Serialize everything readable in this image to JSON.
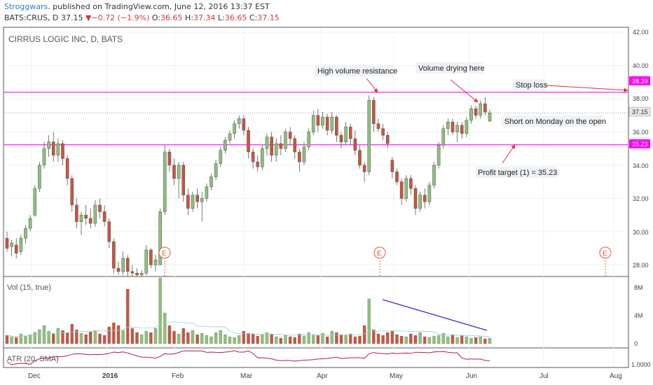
{
  "header": {
    "user": "Stroggwars",
    "published": ". published on TradingView.com, June 12, 2016 13:37 EST",
    "symbol": "BATS:CRUS, D",
    "last": "37.15",
    "change": "−0.72 (−1.9%)",
    "o_label": "O:",
    "o_val": "36.65",
    "h_label": "H:",
    "h_val": "37.34",
    "l_label": "L:",
    "l_val": "36.65",
    "c_label": "C:",
    "c_val": "37.15"
  },
  "price_pane": {
    "title": "CIRRUS LOGIC INC, D, BATS",
    "yticks": [
      "42.00",
      "40.00",
      "38.00",
      "36.00",
      "34.00",
      "32.00",
      "30.00",
      "28.00"
    ],
    "tags": [
      {
        "label": "38.39",
        "value": 38.39,
        "type": "line"
      },
      {
        "label": "37.15",
        "value": 37.15,
        "type": "last"
      },
      {
        "label": "35.23",
        "value": 35.23,
        "type": "line"
      }
    ],
    "annotations": [
      "High volume resistance",
      "Volume drying here",
      "Stop loss",
      "Short on Monday on the open",
      "Profit target (1) = 35.23"
    ],
    "earnings_marker": "E"
  },
  "volume_pane": {
    "title": "Vol (15, true)",
    "yticks": [
      "8M",
      "4M",
      "0"
    ]
  },
  "atr_pane": {
    "title": "ATR (20, SMA)",
    "ytick": "1.0000"
  },
  "xaxis": {
    "ticks": [
      "Dec",
      "2016",
      "Feb",
      "Mar",
      "Apr",
      "May",
      "Jun",
      "Jul",
      "Aug"
    ]
  },
  "colors": {
    "up": "#8fc07a",
    "down": "#c8553f",
    "level_line": "#ff00ff",
    "arrow": "#e0303a",
    "trend": "#3030d8"
  },
  "chart_data": {
    "type": "candlestick",
    "title": "CIRRUS LOGIC INC, D, BATS",
    "ylim": [
      27.3,
      42.3
    ],
    "levels": [
      38.39,
      35.23
    ],
    "last_price": 37.15,
    "candles": [
      {
        "o": 29.6,
        "h": 30.0,
        "l": 28.8,
        "c": 29.0
      },
      {
        "o": 29.1,
        "h": 29.5,
        "l": 28.5,
        "c": 29.3
      },
      {
        "o": 29.2,
        "h": 29.6,
        "l": 28.4,
        "c": 28.7
      },
      {
        "o": 28.8,
        "h": 29.8,
        "l": 28.6,
        "c": 29.6
      },
      {
        "o": 29.6,
        "h": 30.4,
        "l": 29.3,
        "c": 30.2
      },
      {
        "o": 30.2,
        "h": 31.0,
        "l": 30.0,
        "c": 30.8
      },
      {
        "o": 31.0,
        "h": 32.8,
        "l": 30.9,
        "c": 32.6
      },
      {
        "o": 32.6,
        "h": 34.2,
        "l": 32.4,
        "c": 34.0
      },
      {
        "o": 34.0,
        "h": 35.4,
        "l": 33.8,
        "c": 35.0
      },
      {
        "o": 35.0,
        "h": 35.8,
        "l": 34.5,
        "c": 35.4
      },
      {
        "o": 35.4,
        "h": 36.0,
        "l": 34.2,
        "c": 34.6
      },
      {
        "o": 34.6,
        "h": 35.6,
        "l": 34.2,
        "c": 35.3
      },
      {
        "o": 35.3,
        "h": 35.5,
        "l": 34.0,
        "c": 34.4
      },
      {
        "o": 34.4,
        "h": 34.6,
        "l": 32.8,
        "c": 33.2
      },
      {
        "o": 33.2,
        "h": 33.4,
        "l": 31.2,
        "c": 31.6
      },
      {
        "o": 31.6,
        "h": 32.0,
        "l": 30.2,
        "c": 30.6
      },
      {
        "o": 30.6,
        "h": 31.2,
        "l": 29.8,
        "c": 31.0
      },
      {
        "o": 31.0,
        "h": 31.6,
        "l": 30.4,
        "c": 30.8
      },
      {
        "o": 30.8,
        "h": 31.4,
        "l": 30.2,
        "c": 30.5
      },
      {
        "o": 30.5,
        "h": 31.9,
        "l": 30.3,
        "c": 31.6
      },
      {
        "o": 31.6,
        "h": 32.0,
        "l": 30.8,
        "c": 31.2
      },
      {
        "o": 31.2,
        "h": 31.6,
        "l": 30.3,
        "c": 30.6
      },
      {
        "o": 30.6,
        "h": 30.8,
        "l": 29.0,
        "c": 29.4
      },
      {
        "o": 29.4,
        "h": 29.6,
        "l": 27.5,
        "c": 27.8
      },
      {
        "o": 27.8,
        "h": 28.2,
        "l": 27.4,
        "c": 27.6
      },
      {
        "o": 27.6,
        "h": 28.8,
        "l": 27.4,
        "c": 28.4
      },
      {
        "o": 28.4,
        "h": 28.6,
        "l": 27.3,
        "c": 27.6
      },
      {
        "o": 27.6,
        "h": 28.0,
        "l": 27.3,
        "c": 27.5
      },
      {
        "o": 27.5,
        "h": 27.8,
        "l": 27.3,
        "c": 27.4
      },
      {
        "o": 27.4,
        "h": 27.7,
        "l": 27.3,
        "c": 27.5
      },
      {
        "o": 27.5,
        "h": 29.2,
        "l": 27.4,
        "c": 28.9
      },
      {
        "o": 28.9,
        "h": 29.0,
        "l": 27.8,
        "c": 28.0
      },
      {
        "o": 28.0,
        "h": 28.6,
        "l": 27.6,
        "c": 28.3
      },
      {
        "o": 28.0,
        "h": 31.4,
        "l": 29.6,
        "c": 31.2
      },
      {
        "o": 31.2,
        "h": 35.2,
        "l": 31.0,
        "c": 34.8
      },
      {
        "o": 34.8,
        "h": 35.0,
        "l": 33.6,
        "c": 34.0
      },
      {
        "o": 34.0,
        "h": 34.4,
        "l": 32.8,
        "c": 33.2
      },
      {
        "o": 33.2,
        "h": 34.2,
        "l": 32.0,
        "c": 34.0
      },
      {
        "o": 34.0,
        "h": 34.2,
        "l": 31.8,
        "c": 32.2
      },
      {
        "o": 32.2,
        "h": 32.6,
        "l": 31.0,
        "c": 31.4
      },
      {
        "o": 31.4,
        "h": 32.4,
        "l": 31.2,
        "c": 32.2
      },
      {
        "o": 32.2,
        "h": 32.6,
        "l": 31.4,
        "c": 31.8
      },
      {
        "o": 31.8,
        "h": 32.4,
        "l": 30.6,
        "c": 32.0
      },
      {
        "o": 32.0,
        "h": 32.9,
        "l": 31.8,
        "c": 32.7
      },
      {
        "o": 32.7,
        "h": 33.5,
        "l": 32.5,
        "c": 33.3
      },
      {
        "o": 33.3,
        "h": 34.3,
        "l": 33.1,
        "c": 34.1
      },
      {
        "o": 34.1,
        "h": 35.1,
        "l": 33.9,
        "c": 34.9
      },
      {
        "o": 34.9,
        "h": 35.7,
        "l": 34.7,
        "c": 35.5
      },
      {
        "o": 35.5,
        "h": 36.1,
        "l": 35.3,
        "c": 35.9
      },
      {
        "o": 35.9,
        "h": 36.7,
        "l": 35.6,
        "c": 36.5
      },
      {
        "o": 36.5,
        "h": 37.0,
        "l": 36.2,
        "c": 36.8
      },
      {
        "o": 36.8,
        "h": 37.0,
        "l": 35.8,
        "c": 36.1
      },
      {
        "o": 36.1,
        "h": 36.3,
        "l": 34.4,
        "c": 34.8
      },
      {
        "o": 34.8,
        "h": 35.0,
        "l": 33.8,
        "c": 34.2
      },
      {
        "o": 34.2,
        "h": 34.6,
        "l": 33.6,
        "c": 33.9
      },
      {
        "o": 33.9,
        "h": 35.2,
        "l": 33.7,
        "c": 35.0
      },
      {
        "o": 35.0,
        "h": 35.9,
        "l": 34.6,
        "c": 35.7
      },
      {
        "o": 35.7,
        "h": 36.0,
        "l": 34.2,
        "c": 34.6
      },
      {
        "o": 34.6,
        "h": 35.6,
        "l": 34.2,
        "c": 35.3
      },
      {
        "o": 35.3,
        "h": 35.8,
        "l": 34.6,
        "c": 35.0
      },
      {
        "o": 35.0,
        "h": 36.2,
        "l": 34.8,
        "c": 36.0
      },
      {
        "o": 36.0,
        "h": 36.3,
        "l": 35.2,
        "c": 35.6
      },
      {
        "o": 35.6,
        "h": 35.8,
        "l": 34.4,
        "c": 34.8
      },
      {
        "o": 34.8,
        "h": 35.0,
        "l": 33.6,
        "c": 34.2
      },
      {
        "o": 34.2,
        "h": 35.4,
        "l": 34.0,
        "c": 35.1
      },
      {
        "o": 35.1,
        "h": 36.2,
        "l": 34.9,
        "c": 36.0
      },
      {
        "o": 36.0,
        "h": 37.3,
        "l": 35.8,
        "c": 37.0
      },
      {
        "o": 37.0,
        "h": 37.4,
        "l": 36.0,
        "c": 36.4
      },
      {
        "o": 36.4,
        "h": 37.2,
        "l": 36.2,
        "c": 36.9
      },
      {
        "o": 36.9,
        "h": 37.1,
        "l": 35.8,
        "c": 36.1
      },
      {
        "o": 36.1,
        "h": 37.2,
        "l": 35.9,
        "c": 36.9
      },
      {
        "o": 36.9,
        "h": 37.0,
        "l": 35.4,
        "c": 35.8
      },
      {
        "o": 35.8,
        "h": 36.0,
        "l": 35.0,
        "c": 35.4
      },
      {
        "o": 35.4,
        "h": 36.6,
        "l": 35.2,
        "c": 36.3
      },
      {
        "o": 36.3,
        "h": 36.5,
        "l": 35.2,
        "c": 35.6
      },
      {
        "o": 35.6,
        "h": 36.1,
        "l": 34.6,
        "c": 34.9
      },
      {
        "o": 34.9,
        "h": 35.2,
        "l": 33.8,
        "c": 34.0
      },
      {
        "o": 34.0,
        "h": 34.2,
        "l": 33.0,
        "c": 33.6
      },
      {
        "o": 33.6,
        "h": 38.2,
        "l": 33.4,
        "c": 37.9
      },
      {
        "o": 37.9,
        "h": 38.1,
        "l": 36.0,
        "c": 36.5
      },
      {
        "o": 36.5,
        "h": 36.8,
        "l": 36.0,
        "c": 36.2
      },
      {
        "o": 36.2,
        "h": 36.5,
        "l": 35.5,
        "c": 35.8
      },
      {
        "o": 35.8,
        "h": 36.0,
        "l": 35.0,
        "c": 35.3
      },
      {
        "o": 34.3,
        "h": 34.5,
        "l": 33.2,
        "c": 33.6
      },
      {
        "o": 33.6,
        "h": 33.8,
        "l": 32.8,
        "c": 33.0
      },
      {
        "o": 33.0,
        "h": 33.2,
        "l": 31.6,
        "c": 32.0
      },
      {
        "o": 32.0,
        "h": 33.4,
        "l": 31.8,
        "c": 33.2
      },
      {
        "o": 33.2,
        "h": 33.4,
        "l": 32.2,
        "c": 32.6
      },
      {
        "o": 32.6,
        "h": 32.8,
        "l": 31.0,
        "c": 31.4
      },
      {
        "o": 31.4,
        "h": 32.4,
        "l": 31.2,
        "c": 32.2
      },
      {
        "o": 32.2,
        "h": 32.6,
        "l": 31.4,
        "c": 31.8
      },
      {
        "o": 31.8,
        "h": 33.0,
        "l": 31.6,
        "c": 32.8
      },
      {
        "o": 32.8,
        "h": 34.2,
        "l": 32.6,
        "c": 34.0
      },
      {
        "o": 34.0,
        "h": 35.4,
        "l": 33.8,
        "c": 35.2
      },
      {
        "o": 35.2,
        "h": 36.4,
        "l": 35.0,
        "c": 36.2
      },
      {
        "o": 36.2,
        "h": 36.8,
        "l": 35.8,
        "c": 36.6
      },
      {
        "o": 36.6,
        "h": 36.8,
        "l": 35.8,
        "c": 36.0
      },
      {
        "o": 36.0,
        "h": 36.6,
        "l": 35.4,
        "c": 36.4
      },
      {
        "o": 36.4,
        "h": 36.6,
        "l": 35.6,
        "c": 35.9
      },
      {
        "o": 35.9,
        "h": 36.9,
        "l": 35.7,
        "c": 36.7
      },
      {
        "o": 36.7,
        "h": 37.6,
        "l": 36.5,
        "c": 37.4
      },
      {
        "o": 37.4,
        "h": 37.6,
        "l": 36.8,
        "c": 37.0
      },
      {
        "o": 37.0,
        "h": 37.9,
        "l": 36.8,
        "c": 37.7
      },
      {
        "o": 37.7,
        "h": 38.1,
        "l": 37.0,
        "c": 37.2
      },
      {
        "o": 36.65,
        "h": 37.34,
        "l": 36.65,
        "c": 37.15
      }
    ],
    "volume_millions": [
      1.2,
      1.0,
      0.9,
      1.4,
      1.1,
      1.3,
      1.6,
      2.0,
      2.6,
      1.8,
      1.4,
      2.2,
      1.9,
      1.6,
      2.8,
      2.0,
      1.5,
      1.3,
      1.7,
      1.9,
      1.4,
      1.2,
      2.4,
      3.0,
      2.6,
      1.9,
      7.8,
      2.2,
      1.6,
      1.3,
      1.8,
      1.6,
      2.2,
      9.8,
      4.4,
      2.6,
      1.8,
      1.4,
      2.2,
      1.6,
      1.9,
      1.3,
      1.5,
      1.2,
      1.0,
      1.6,
      1.9,
      1.3,
      1.0,
      0.9,
      1.2,
      1.8,
      1.5,
      1.4,
      1.1,
      1.3,
      1.6,
      1.4,
      1.0,
      0.8,
      1.2,
      1.0,
      0.9,
      1.4,
      1.1,
      1.6,
      1.3,
      1.2,
      1.5,
      1.0,
      1.8,
      1.6,
      1.3,
      1.2,
      1.4,
      1.0,
      1.1,
      2.6,
      6.4,
      2.0,
      1.4,
      1.2,
      1.6,
      1.8,
      1.3,
      1.1,
      1.0,
      1.4,
      1.2,
      1.6,
      1.0,
      0.9,
      1.1,
      1.2,
      1.5,
      1.0,
      1.3,
      0.9,
      1.2,
      1.0,
      0.8,
      0.9,
      1.0,
      0.7,
      0.8
    ]
  }
}
